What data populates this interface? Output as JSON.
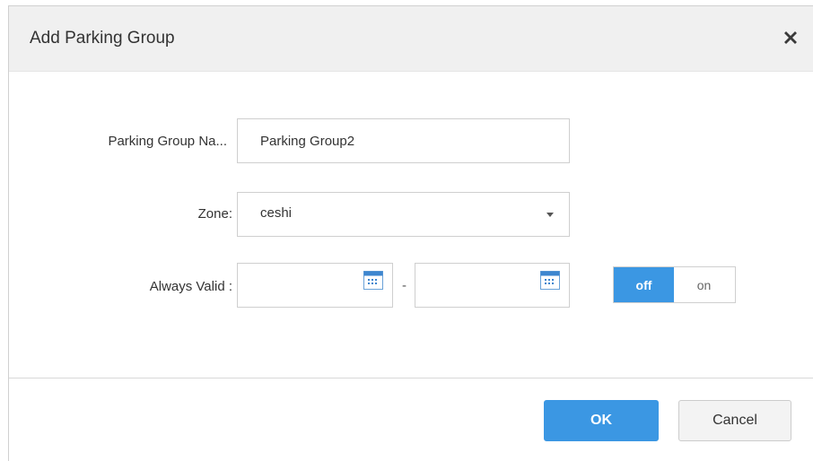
{
  "dialog": {
    "title": "Add Parking Group",
    "close_icon": "close-icon"
  },
  "form": {
    "name_label": "Parking Group Na...",
    "name_value": "Parking Group2",
    "zone_label": "Zone:",
    "zone_value": "ceshi",
    "validity_label": "Always Valid :",
    "start_date": "",
    "end_date": "",
    "date_separator": "-",
    "calendar_icon": "calendar-icon",
    "toggle": {
      "off_label": "off",
      "on_label": "on",
      "selected": "off"
    }
  },
  "footer": {
    "ok_label": "OK",
    "cancel_label": "Cancel"
  },
  "colors": {
    "accent": "#3b97e3",
    "header_bg": "#f0f0f0",
    "border": "#cfcfcf"
  }
}
